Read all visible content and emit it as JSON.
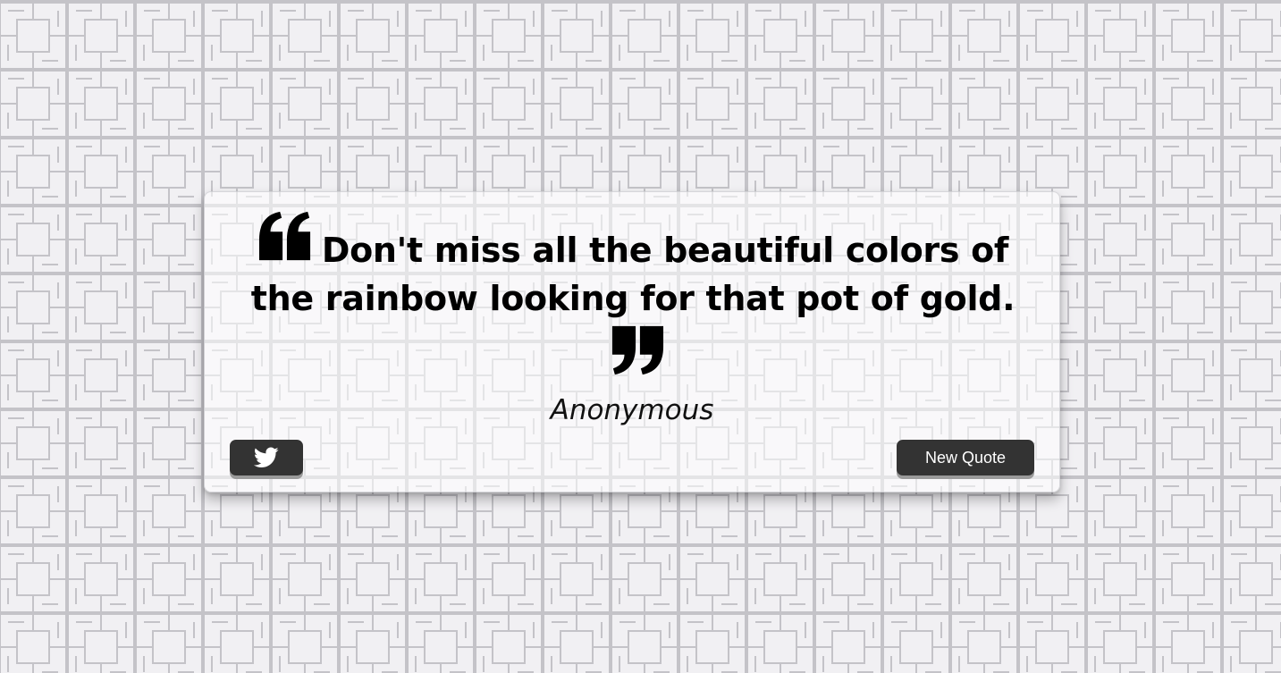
{
  "quote": {
    "text": "Don't miss all the beautiful colors of the rainbow looking for that pot of gold.",
    "author": "Anonymous",
    "open_icon": "quote-left-icon",
    "close_icon": "quote-right-icon"
  },
  "actions": {
    "tweet_icon": "twitter-icon",
    "new_quote_label": "New Quote"
  },
  "colors": {
    "background": "#f1f0f3",
    "pattern_lines": "#c2c1c6",
    "button": "#333333",
    "button_shadow": "#9a9a9a",
    "text": "#000000"
  }
}
